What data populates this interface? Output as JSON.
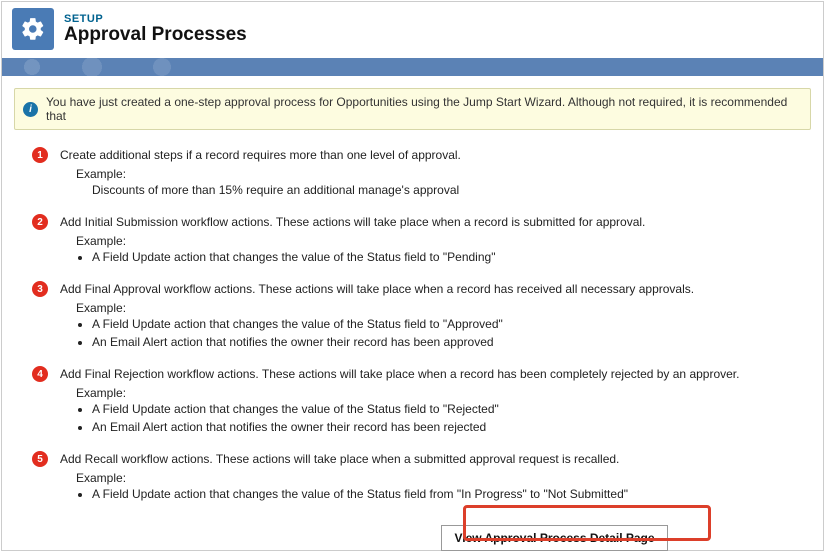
{
  "header": {
    "breadcrumb": "SETUP",
    "title": "Approval Processes"
  },
  "banner": {
    "text": "You have just created a one-step approval process for Opportunities using the Jump Start Wizard. Although not required, it is recommended that"
  },
  "steps": [
    {
      "num": "1",
      "title": "Create additional steps if a record requires more than one level of approval.",
      "example_label": "Example:",
      "single_example": "Discounts of more than 15% require an additional manage's approval"
    },
    {
      "num": "2",
      "title": "Add Initial Submission workflow actions. These actions will take place when a record is submitted for approval.",
      "example_label": "Example:",
      "bullets": [
        "A Field Update action that changes the value of the Status field to \"Pending\""
      ]
    },
    {
      "num": "3",
      "title": "Add Final Approval workflow actions. These actions will take place when a record has received all necessary approvals.",
      "example_label": "Example:",
      "bullets": [
        "A Field Update action that changes the value of the Status field to \"Approved\"",
        "An Email Alert action that notifies the owner their record has been approved"
      ]
    },
    {
      "num": "4",
      "title": "Add Final Rejection workflow actions. These actions will take place when a record has been completely rejected by an approver.",
      "example_label": "Example:",
      "bullets": [
        "A Field Update action that changes the value of the Status field to \"Rejected\"",
        "An Email Alert action that notifies the owner their record has been rejected"
      ]
    },
    {
      "num": "5",
      "title": "Add Recall workflow actions. These actions will take place when a submitted approval request is recalled.",
      "example_label": "Example:",
      "bullets": [
        "A Field Update action that changes the value of the Status field from \"In Progress\" to \"Not Submitted\""
      ]
    }
  ],
  "button": {
    "label": "View Approval Process Detail Page"
  }
}
